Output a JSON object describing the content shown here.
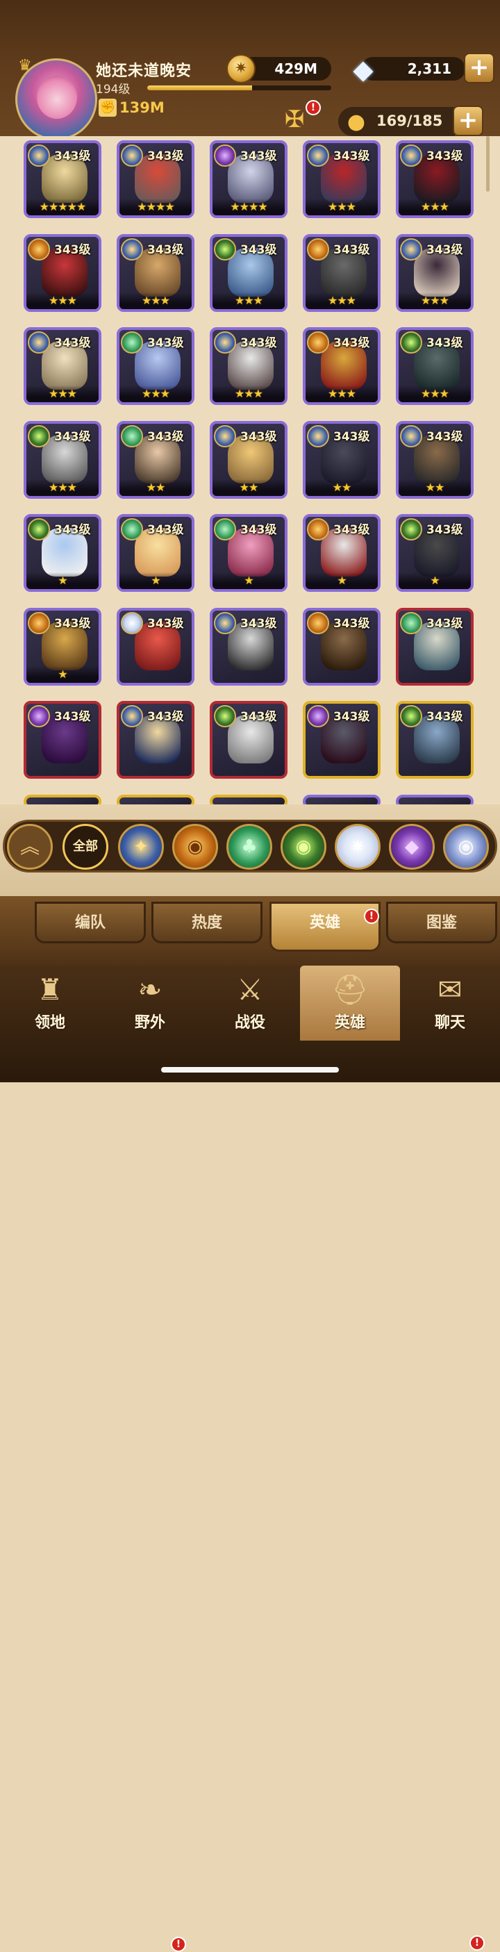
{
  "player": {
    "name": "她还未道晚安",
    "level": "194级",
    "xp_fraction": 0.57,
    "power": "139M"
  },
  "resources": {
    "gold": "429M",
    "gems": "2,311"
  },
  "roster": {
    "count": "169/185"
  },
  "heroes": [
    {
      "level": "343级",
      "faction": "lightbearer",
      "stars": "★★★★★",
      "frame": "purple",
      "c1": "#f0d9a0",
      "c2": "#7a6a3a"
    },
    {
      "level": "343级",
      "faction": "lightbearer",
      "stars": "★★★★",
      "frame": "purple",
      "c1": "#d94a3a",
      "c2": "#6a5a5a"
    },
    {
      "level": "343级",
      "faction": "hypogean",
      "stars": "★★★★",
      "frame": "purple",
      "c1": "#d0d4e8",
      "c2": "#5a5a7a"
    },
    {
      "level": "343级",
      "faction": "lightbearer",
      "stars": "★★★",
      "frame": "purple",
      "c1": "#b8262a",
      "c2": "#3a3a5a"
    },
    {
      "level": "343级",
      "faction": "lightbearer",
      "stars": "★★★",
      "frame": "purple",
      "c1": "#8a1a22",
      "c2": "#1a1a22"
    },
    {
      "level": "343级",
      "faction": "mauler",
      "stars": "★★★",
      "frame": "purple",
      "c1": "#c9373a",
      "c2": "#3a1010"
    },
    {
      "level": "343级",
      "faction": "lightbearer",
      "stars": "★★★",
      "frame": "purple",
      "c1": "#d8a86a",
      "c2": "#6a4a2a"
    },
    {
      "level": "343级",
      "faction": "graveborn",
      "stars": "★★★",
      "frame": "purple",
      "c1": "#aac8e8",
      "c2": "#3a5a8a"
    },
    {
      "level": "343级",
      "faction": "mauler",
      "stars": "★★★",
      "frame": "purple",
      "c1": "#6a6a6a",
      "c2": "#2a2a2a"
    },
    {
      "level": "343级",
      "faction": "lightbearer",
      "stars": "★★★",
      "frame": "purple",
      "c1": "#3a2a3a",
      "c2": "#d8c8b8"
    },
    {
      "level": "343级",
      "faction": "lightbearer",
      "stars": "★★★",
      "frame": "purple",
      "c1": "#f0e0c0",
      "c2": "#8a7a5a"
    },
    {
      "level": "343级",
      "faction": "wilder",
      "stars": "★★★",
      "frame": "purple",
      "c1": "#b8c8f0",
      "c2": "#4a5a9a"
    },
    {
      "level": "343级",
      "faction": "lightbearer",
      "stars": "★★★",
      "frame": "purple",
      "c1": "#e8e8e8",
      "c2": "#5a4a4a"
    },
    {
      "level": "343级",
      "faction": "mauler",
      "stars": "★★★",
      "frame": "purple",
      "c1": "#d8a83a",
      "c2": "#8a1a1a"
    },
    {
      "level": "343级",
      "faction": "graveborn",
      "stars": "★★★",
      "frame": "purple",
      "c1": "#5a6a6a",
      "c2": "#1a2a2a"
    },
    {
      "level": "343级",
      "faction": "graveborn",
      "stars": "★★★",
      "frame": "purple",
      "c1": "#d8d8d8",
      "c2": "#5a5a5a"
    },
    {
      "level": "343级",
      "faction": "wilder",
      "stars": "★★",
      "frame": "purple",
      "c1": "#e8c8a8",
      "c2": "#4a3a2a"
    },
    {
      "level": "343级",
      "faction": "lightbearer",
      "stars": "★★",
      "frame": "purple",
      "c1": "#f0c878",
      "c2": "#8a6a3a"
    },
    {
      "level": "343级",
      "faction": "lightbearer",
      "stars": "★★",
      "frame": "purple",
      "c1": "#4a4a5a",
      "c2": "#1a1a2a"
    },
    {
      "level": "343级",
      "faction": "lightbearer",
      "stars": "★★",
      "frame": "purple",
      "c1": "#8a6a4a",
      "c2": "#2a2a2a"
    },
    {
      "level": "343级",
      "faction": "graveborn",
      "stars": "★",
      "frame": "purple",
      "c1": "#aac8f0",
      "c2": "#f0f0f0"
    },
    {
      "level": "343级",
      "faction": "wilder",
      "stars": "★",
      "frame": "purple",
      "c1": "#f8e0a0",
      "c2": "#d89a5a"
    },
    {
      "level": "343级",
      "faction": "wilder",
      "stars": "★",
      "frame": "purple",
      "c1": "#f0a0c0",
      "c2": "#8a2a4a"
    },
    {
      "level": "343级",
      "faction": "mauler",
      "stars": "★",
      "frame": "purple",
      "c1": "#e8e8e8",
      "c2": "#8a1a1a"
    },
    {
      "level": "343级",
      "faction": "graveborn",
      "stars": "★",
      "frame": "purple",
      "c1": "#4a4a4a",
      "c2": "#1a1a2a"
    },
    {
      "level": "343级",
      "faction": "mauler",
      "stars": "★",
      "frame": "purple",
      "c1": "#d8a84a",
      "c2": "#5a3a1a"
    },
    {
      "level": "343级",
      "faction": "celestial",
      "stars": "",
      "frame": "purple",
      "c1": "#e8584a",
      "c2": "#7a1a1a"
    },
    {
      "level": "343级",
      "faction": "lightbearer",
      "stars": "",
      "frame": "purple",
      "c1": "#d8d8d8",
      "c2": "#2a2a2a"
    },
    {
      "level": "343级",
      "faction": "mauler",
      "stars": "",
      "frame": "purple",
      "c1": "#8a6a4a",
      "c2": "#2a1a0a"
    },
    {
      "level": "343级",
      "faction": "wilder",
      "stars": "",
      "frame": "red",
      "c1": "#d8d8c8",
      "c2": "#3a5a6a"
    },
    {
      "level": "343级",
      "faction": "hypogean",
      "stars": "",
      "frame": "red",
      "c1": "#6a3a8a",
      "c2": "#2a0a3a"
    },
    {
      "level": "343级",
      "faction": "lightbearer",
      "stars": "",
      "frame": "red",
      "c1": "#f0d8a0",
      "c2": "#1a2a5a"
    },
    {
      "level": "343级",
      "faction": "graveborn",
      "stars": "",
      "frame": "red",
      "c1": "#e8e8e8",
      "c2": "#7a7a7a"
    },
    {
      "level": "343级",
      "faction": "hypogean",
      "stars": "",
      "frame": "gold",
      "c1": "#5a5a6a",
      "c2": "#2a0a1a"
    },
    {
      "level": "343级",
      "faction": "graveborn",
      "stars": "",
      "frame": "gold",
      "c1": "#8aa8c8",
      "c2": "#2a3a4a"
    }
  ],
  "filters": {
    "up_label": "︽",
    "all_label": "全部",
    "items": [
      {
        "faction": "lightbearer",
        "glyph": "✦"
      },
      {
        "faction": "mauler",
        "glyph": "◉"
      },
      {
        "faction": "wilder",
        "glyph": "♣"
      },
      {
        "faction": "graveborn",
        "glyph": "◉"
      },
      {
        "faction": "celestial",
        "glyph": "✷"
      },
      {
        "faction": "hypogean",
        "glyph": "◆"
      },
      {
        "faction": "dimensional",
        "glyph": "◎"
      }
    ]
  },
  "subtabs": {
    "formation": "编队",
    "popularity": "热度",
    "heroes": "英雄",
    "codex": "图鉴"
  },
  "nav": {
    "territory": "领地",
    "wilds": "野外",
    "campaign": "战役",
    "heroes": "英雄",
    "chat": "聊天"
  },
  "badges": {
    "alert": "!"
  },
  "colors": {
    "accent_gold": "#f7c94a",
    "badge_red": "#d4241d",
    "frame_purple": "#8a6bd8",
    "frame_red": "#b22a35",
    "frame_gold": "#e0b228"
  }
}
